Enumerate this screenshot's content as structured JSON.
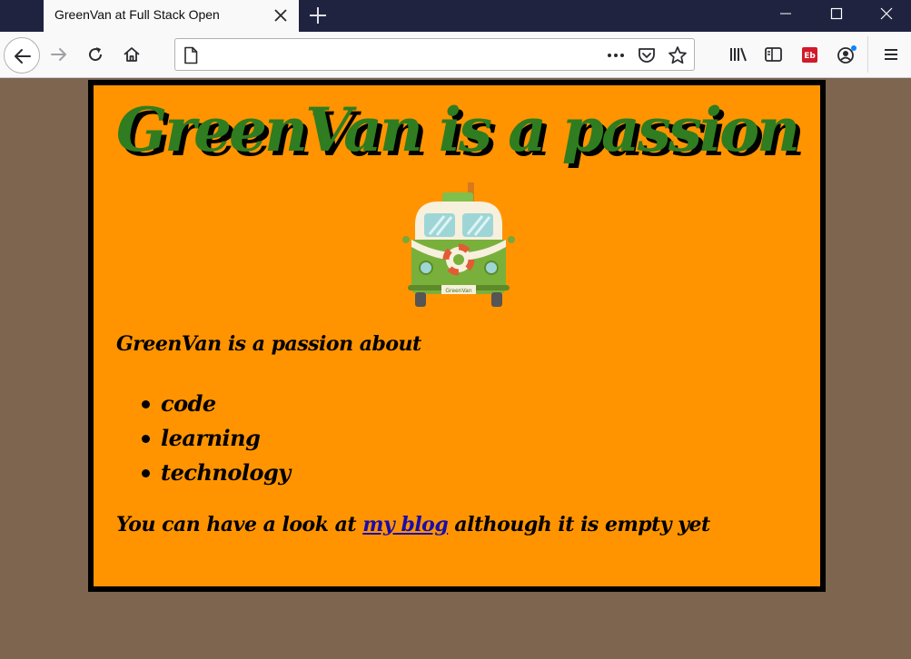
{
  "browser": {
    "tab_title": "GreenVan at Full Stack Open",
    "url_value": "",
    "icons": [
      "close-icon",
      "plus-icon",
      "minimize-icon",
      "maximize-icon",
      "window-close-icon",
      "back-arrow-icon",
      "forward-arrow-icon",
      "reload-icon",
      "home-icon",
      "page-icon",
      "more-dots-icon",
      "pocket-icon",
      "star-icon",
      "library-icon",
      "sidebar-icon",
      "extension-icon",
      "account-icon",
      "menu-icon"
    ]
  },
  "page": {
    "title": "GreenVan is a passion",
    "van_plate": "GreenVan",
    "intro": "GreenVan is a passion about",
    "topics": [
      "code",
      "learning",
      "technology"
    ],
    "footer_before": "You can have a look at ",
    "footer_link": "my blog",
    "footer_after": " although it is empty yet"
  },
  "colors": {
    "page_background": "#7d6550",
    "card_background": "#ff9400",
    "title_green": "#2f7d20",
    "link": "#1a0dab"
  }
}
